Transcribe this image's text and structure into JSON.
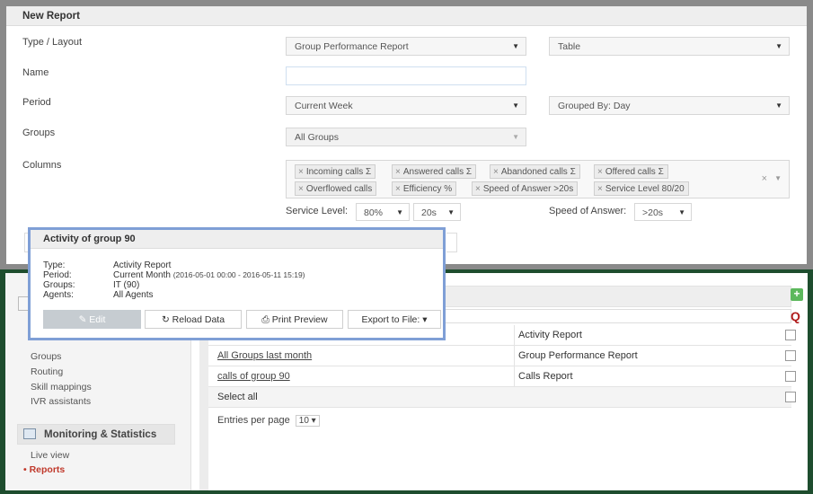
{
  "new_report": {
    "title": "New Report",
    "type_label": "Type / Layout",
    "type_value": "Group Performance Report",
    "layout_value": "Table",
    "name_label": "Name",
    "name_value": "",
    "period_label": "Period",
    "period_value": "Current Week",
    "grouped_by_value": "Grouped By: Day",
    "groups_label": "Groups",
    "groups_value": "All Groups",
    "columns_label": "Columns",
    "columns_tags": [
      "Incoming calls Σ",
      "Answered calls Σ",
      "Abandoned calls Σ",
      "Offered calls Σ",
      "Overflowed calls",
      "Efficiency %",
      "Speed of Answer >20s",
      "Service Level 80/20"
    ],
    "tag_remove_glyph": "×",
    "tags_clear_glyph": "×",
    "service_level_label": "Service Level:",
    "service_level_percent": "80%",
    "service_level_seconds": "20s",
    "speed_of_answer_label": "Speed of Answer:",
    "speed_of_answer_value": ">20s"
  },
  "popup": {
    "title": "Activity of group 90",
    "type_key": "Type:",
    "type_value": "Activity Report",
    "period_key": "Period:",
    "period_value": "Current Month",
    "period_range": "(2016-05-01 00:00 - 2016-05-11 15:19)",
    "groups_key": "Groups:",
    "groups_value": "IT (90)",
    "agents_key": "Agents:",
    "agents_value": "All Agents",
    "edit_label": "✎ Edit",
    "reload_label": "↻ Reload Data",
    "print_label": "⎙ Print Preview",
    "export_label": "Export to File: ▾"
  },
  "sidebar": {
    "items": [
      "Groups",
      "Routing",
      "Skill mappings",
      "IVR assistants"
    ],
    "section_title": "Monitoring & Statistics",
    "live_view": "Live view",
    "reports": "• Reports"
  },
  "reports_table": {
    "rows": [
      {
        "name": "",
        "type": "Activity Report"
      },
      {
        "name": "All Groups last month",
        "type": "Group Performance Report"
      },
      {
        "name": "calls of group 90",
        "type": "Calls Report"
      }
    ],
    "select_all": "Select all",
    "entries_label": "Entries per page",
    "entries_value": "10 ▾"
  },
  "icons": {
    "add": "+",
    "search": "Q",
    "caret": "▼"
  },
  "colors": {
    "top_frame": "#8a8a8a",
    "bottom_frame": "#1e4d2e",
    "popup_border": "#7f9fd6",
    "add_green": "#5cb85c",
    "reports_active": "#c0392b",
    "search_red": "#b01c1c"
  }
}
